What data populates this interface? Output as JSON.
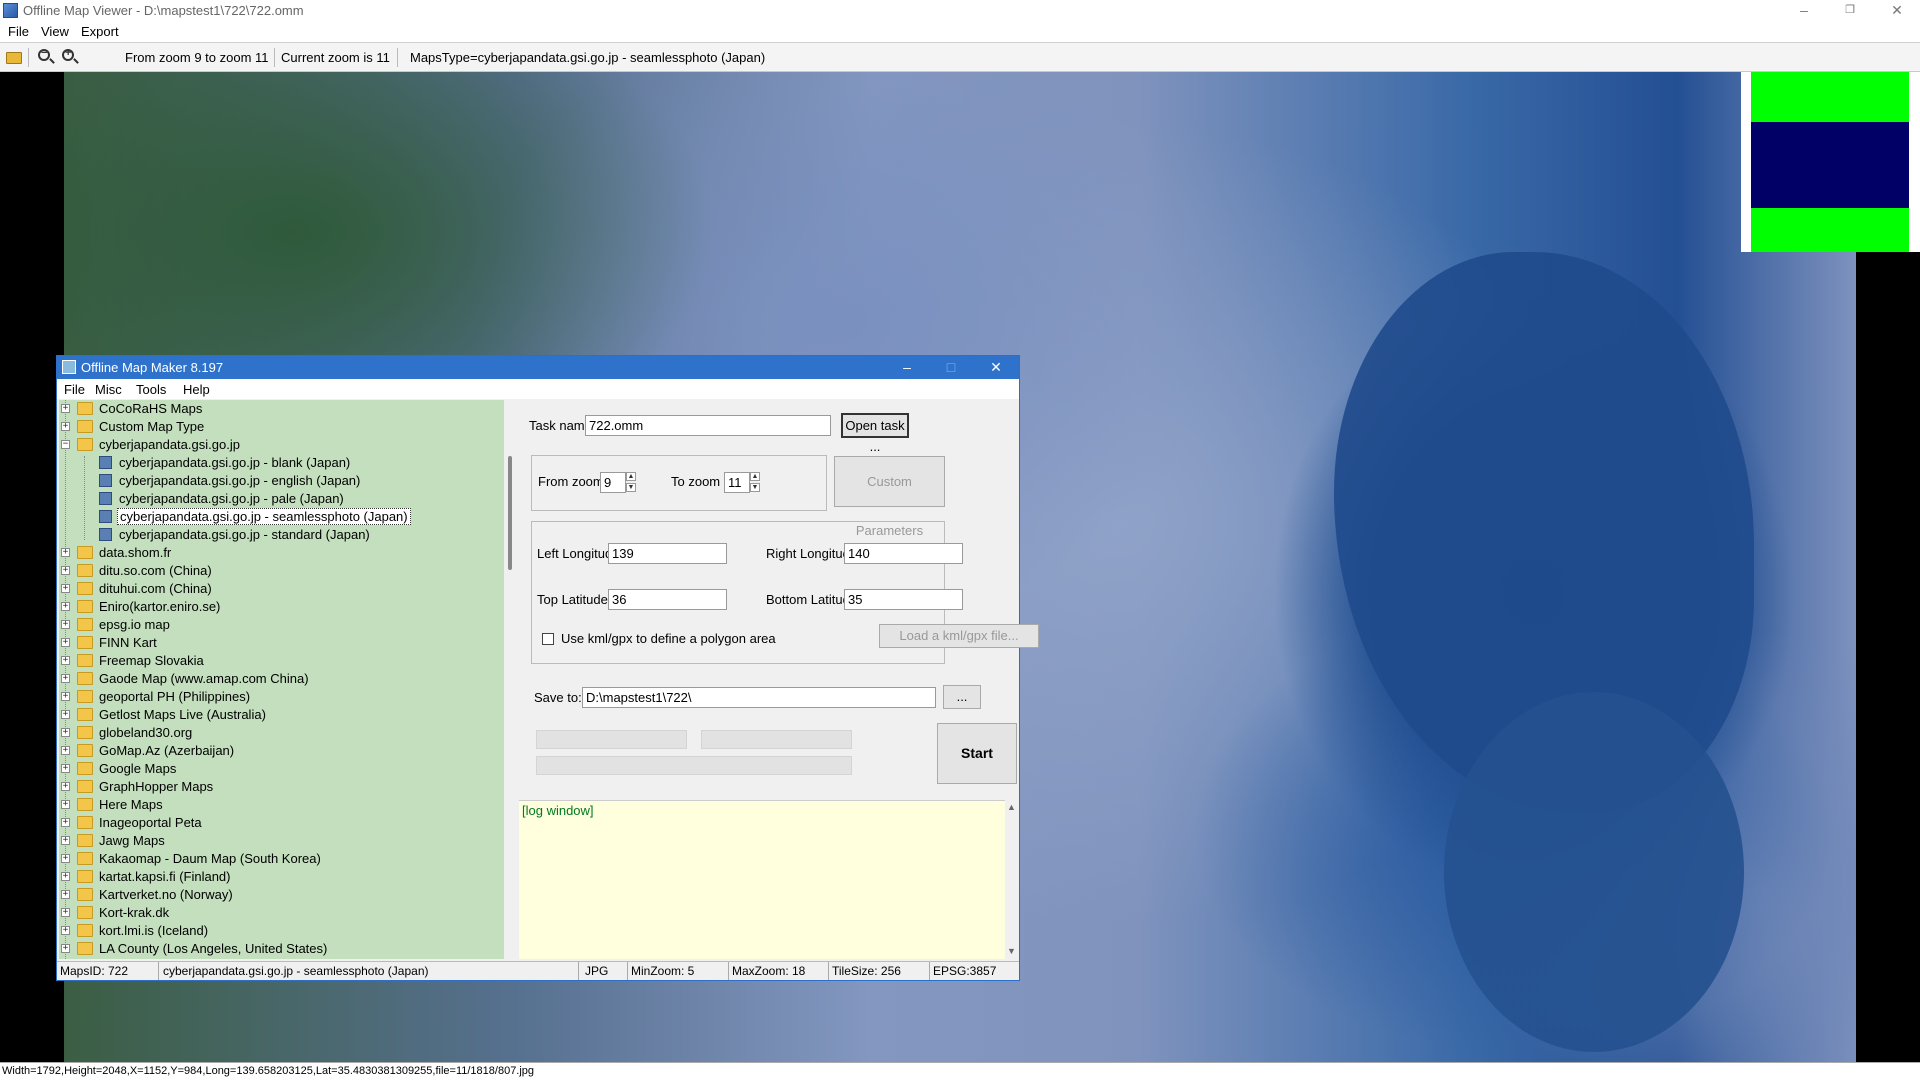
{
  "window": {
    "title": "Offline Map Viewer - D:\\mapstest1\\722\\722.omm",
    "controls": {
      "minimize": "–",
      "restore": "❐",
      "close": "✕"
    }
  },
  "menubar": [
    "File",
    "View",
    "Export"
  ],
  "toolbar": {
    "zoom_range": "From zoom 9 to zoom 11",
    "current_zoom": "Current zoom is 11",
    "maps_type": "MapsType=cyberjapandata.gsi.go.jp - seamlessphoto (Japan)"
  },
  "overview_colors": {
    "top": "#00ff00",
    "middle": "#000066",
    "bottom": "#00ff00"
  },
  "status_line": "Width=1792,Height=2048,X=1152,Y=984,Long=139.658203125,Lat=35.4830381309255,file=11/1818/807.jpg",
  "dialog": {
    "title": "Offline Map Maker 8.197",
    "controls": {
      "minimize": "–",
      "maximize": "□",
      "close": "✕"
    },
    "menu": [
      "File",
      "Misc",
      "Tools",
      "Help"
    ],
    "tree": [
      {
        "label": "CoCoRaHS Maps",
        "type": "folder",
        "level": 0,
        "expander": "+"
      },
      {
        "label": "Custom Map Type",
        "type": "folder",
        "level": 0,
        "expander": "+"
      },
      {
        "label": "cyberjapandata.gsi.go.jp",
        "type": "folder",
        "level": 0,
        "expander": "−"
      },
      {
        "label": "cyberjapandata.gsi.go.jp - blank (Japan)",
        "type": "map",
        "level": 1
      },
      {
        "label": "cyberjapandata.gsi.go.jp - english (Japan)",
        "type": "map",
        "level": 1
      },
      {
        "label": "cyberjapandata.gsi.go.jp - pale (Japan)",
        "type": "map",
        "level": 1
      },
      {
        "label": "cyberjapandata.gsi.go.jp - seamlessphoto (Japan)",
        "type": "map",
        "level": 1,
        "selected": true
      },
      {
        "label": "cyberjapandata.gsi.go.jp - standard (Japan)",
        "type": "map",
        "level": 1
      },
      {
        "label": "data.shom.fr",
        "type": "folder",
        "level": 0,
        "expander": "+"
      },
      {
        "label": "ditu.so.com (China)",
        "type": "folder",
        "level": 0,
        "expander": "+"
      },
      {
        "label": "dituhui.com (China)",
        "type": "folder",
        "level": 0,
        "expander": "+"
      },
      {
        "label": "Eniro(kartor.eniro.se)",
        "type": "folder",
        "level": 0,
        "expander": "+"
      },
      {
        "label": "epsg.io map",
        "type": "folder",
        "level": 0,
        "expander": "+"
      },
      {
        "label": "FINN Kart",
        "type": "folder",
        "level": 0,
        "expander": "+"
      },
      {
        "label": "Freemap Slovakia",
        "type": "folder",
        "level": 0,
        "expander": "+"
      },
      {
        "label": "Gaode Map (www.amap.com China)",
        "type": "folder",
        "level": 0,
        "expander": "+"
      },
      {
        "label": "geoportal PH (Philippines)",
        "type": "folder",
        "level": 0,
        "expander": "+"
      },
      {
        "label": "Getlost Maps Live (Australia)",
        "type": "folder",
        "level": 0,
        "expander": "+"
      },
      {
        "label": "globeland30.org",
        "type": "folder",
        "level": 0,
        "expander": "+"
      },
      {
        "label": "GoMap.Az (Azerbaijan)",
        "type": "folder",
        "level": 0,
        "expander": "+"
      },
      {
        "label": "Google Maps",
        "type": "folder",
        "level": 0,
        "expander": "+"
      },
      {
        "label": "GraphHopper Maps",
        "type": "folder",
        "level": 0,
        "expander": "+"
      },
      {
        "label": "Here Maps",
        "type": "folder",
        "level": 0,
        "expander": "+"
      },
      {
        "label": "Inageoportal Peta",
        "type": "folder",
        "level": 0,
        "expander": "+"
      },
      {
        "label": "Jawg Maps",
        "type": "folder",
        "level": 0,
        "expander": "+"
      },
      {
        "label": "Kakaomap - Daum Map (South Korea)",
        "type": "folder",
        "level": 0,
        "expander": "+"
      },
      {
        "label": "kartat.kapsi.fi (Finland)",
        "type": "folder",
        "level": 0,
        "expander": "+"
      },
      {
        "label": "Kartverket.no (Norway)",
        "type": "folder",
        "level": 0,
        "expander": "+"
      },
      {
        "label": "Kort-krak.dk",
        "type": "folder",
        "level": 0,
        "expander": "+"
      },
      {
        "label": "kort.lmi.is (Iceland)",
        "type": "folder",
        "level": 0,
        "expander": "+"
      },
      {
        "label": "LA County (Los Angeles, United States)",
        "type": "folder",
        "level": 0,
        "expander": "+"
      }
    ],
    "form": {
      "task_name_label": "Task name",
      "task_name_value": "722.omm",
      "open_task_button": "Open task ...",
      "from_zoom_label": "From zoom",
      "from_zoom_value": "9",
      "to_zoom_label": "To zoom",
      "to_zoom_value": "11",
      "custom_params_button": "Custom Parameters",
      "left_longitude_label": "Left Longitude",
      "left_longitude_value": "139",
      "right_longitude_label": "Right Longitude",
      "right_longitude_value": "140",
      "top_latitude_label": "Top Latitude",
      "top_latitude_value": "36",
      "bottom_latitude_label": "Bottom Latitude",
      "bottom_latitude_value": "35",
      "kml_checkbox_label": "Use kml/gpx to define a polygon area",
      "kml_checked": false,
      "load_kml_button": "Load a kml/gpx file...",
      "save_to_label": "Save to:",
      "save_to_value": "D:\\mapstest1\\722\\",
      "browse_button": "...",
      "start_button": "Start"
    },
    "log_text": "[log window]",
    "status": {
      "maps_id": "MapsID: 722",
      "map_name": "cyberjapandata.gsi.go.jp - seamlessphoto (Japan)",
      "format": "JPG",
      "min_zoom": "MinZoom: 5",
      "max_zoom": "MaxZoom: 18",
      "tile_size": "TileSize: 256",
      "epsg": "EPSG:3857"
    }
  }
}
